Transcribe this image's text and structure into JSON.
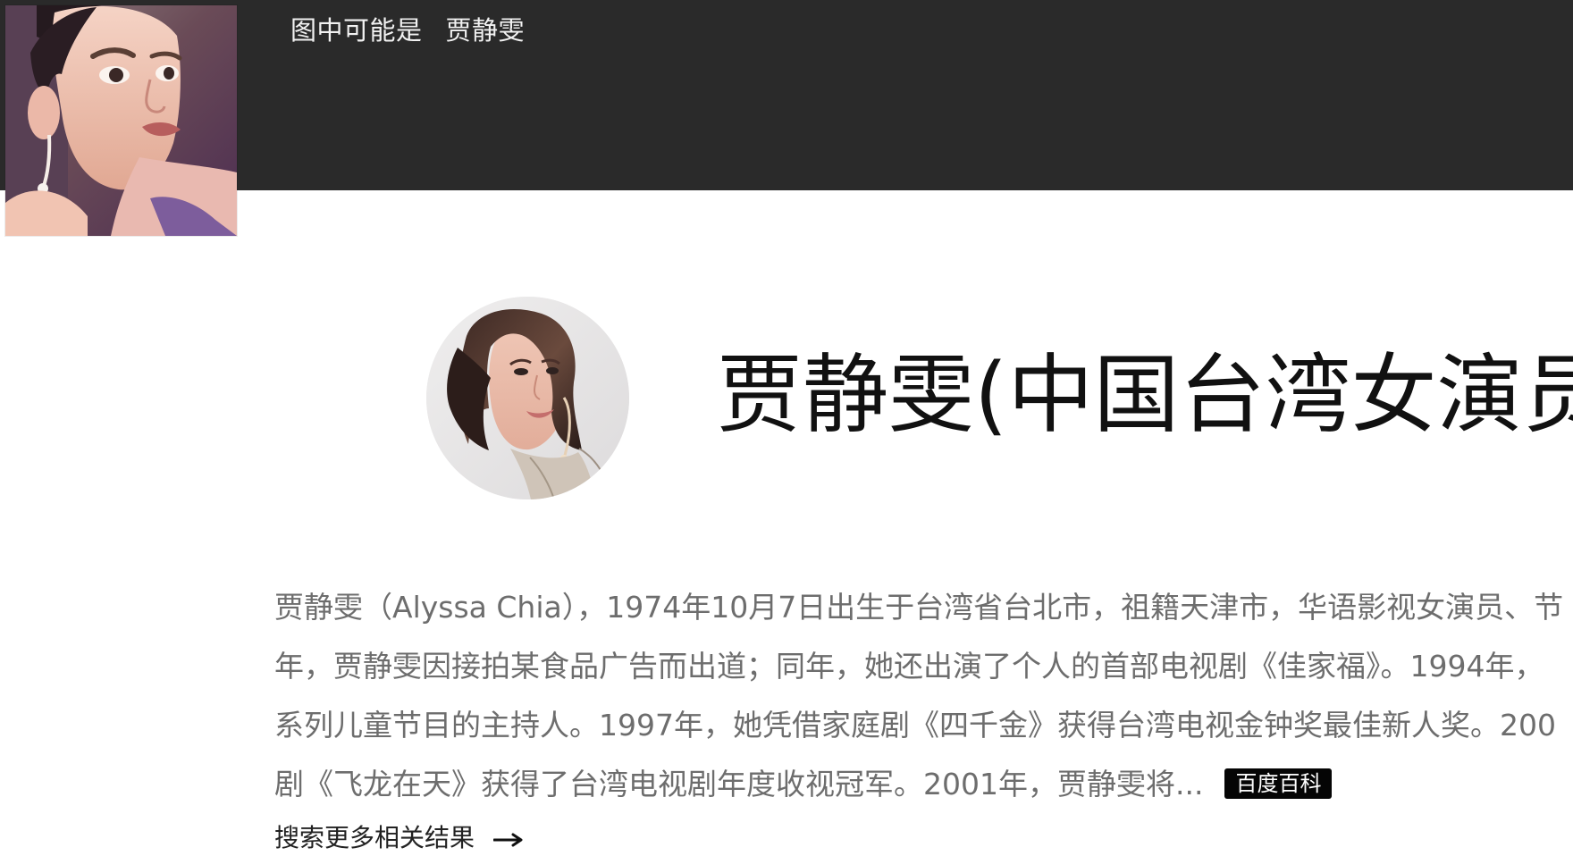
{
  "header": {
    "guess_label": "图中可能是",
    "guess_name": "贾静雯"
  },
  "entity": {
    "title": "贾静雯(中国台湾女演员、"
  },
  "summary": {
    "lines": [
      "贾静雯（Alyssa Chia），1974年10月7日出生于台湾省台北市，祖籍天津市，华语影视女演员、节",
      "年，贾静雯因接拍某食品广告而出道；同年，她还出演了个人的首部电视剧《佳家福》。1994年，",
      "系列儿童节目的主持人。1997年，她凭借家庭剧《四千金》获得台湾电视金钟奖最佳新人奖。200",
      "剧《飞龙在天》获得了台湾电视剧年度收视冠军。2001年，贾静雯将..."
    ],
    "source_badge": "百度百科"
  },
  "more": {
    "label": "搜索更多相关结果"
  },
  "icons": {
    "arrow": "right-arrow-icon"
  },
  "colors": {
    "header_bg": "#2a2a2a",
    "summary_text": "#6d6d6d",
    "title_text": "#111111",
    "badge_bg": "#050505"
  }
}
